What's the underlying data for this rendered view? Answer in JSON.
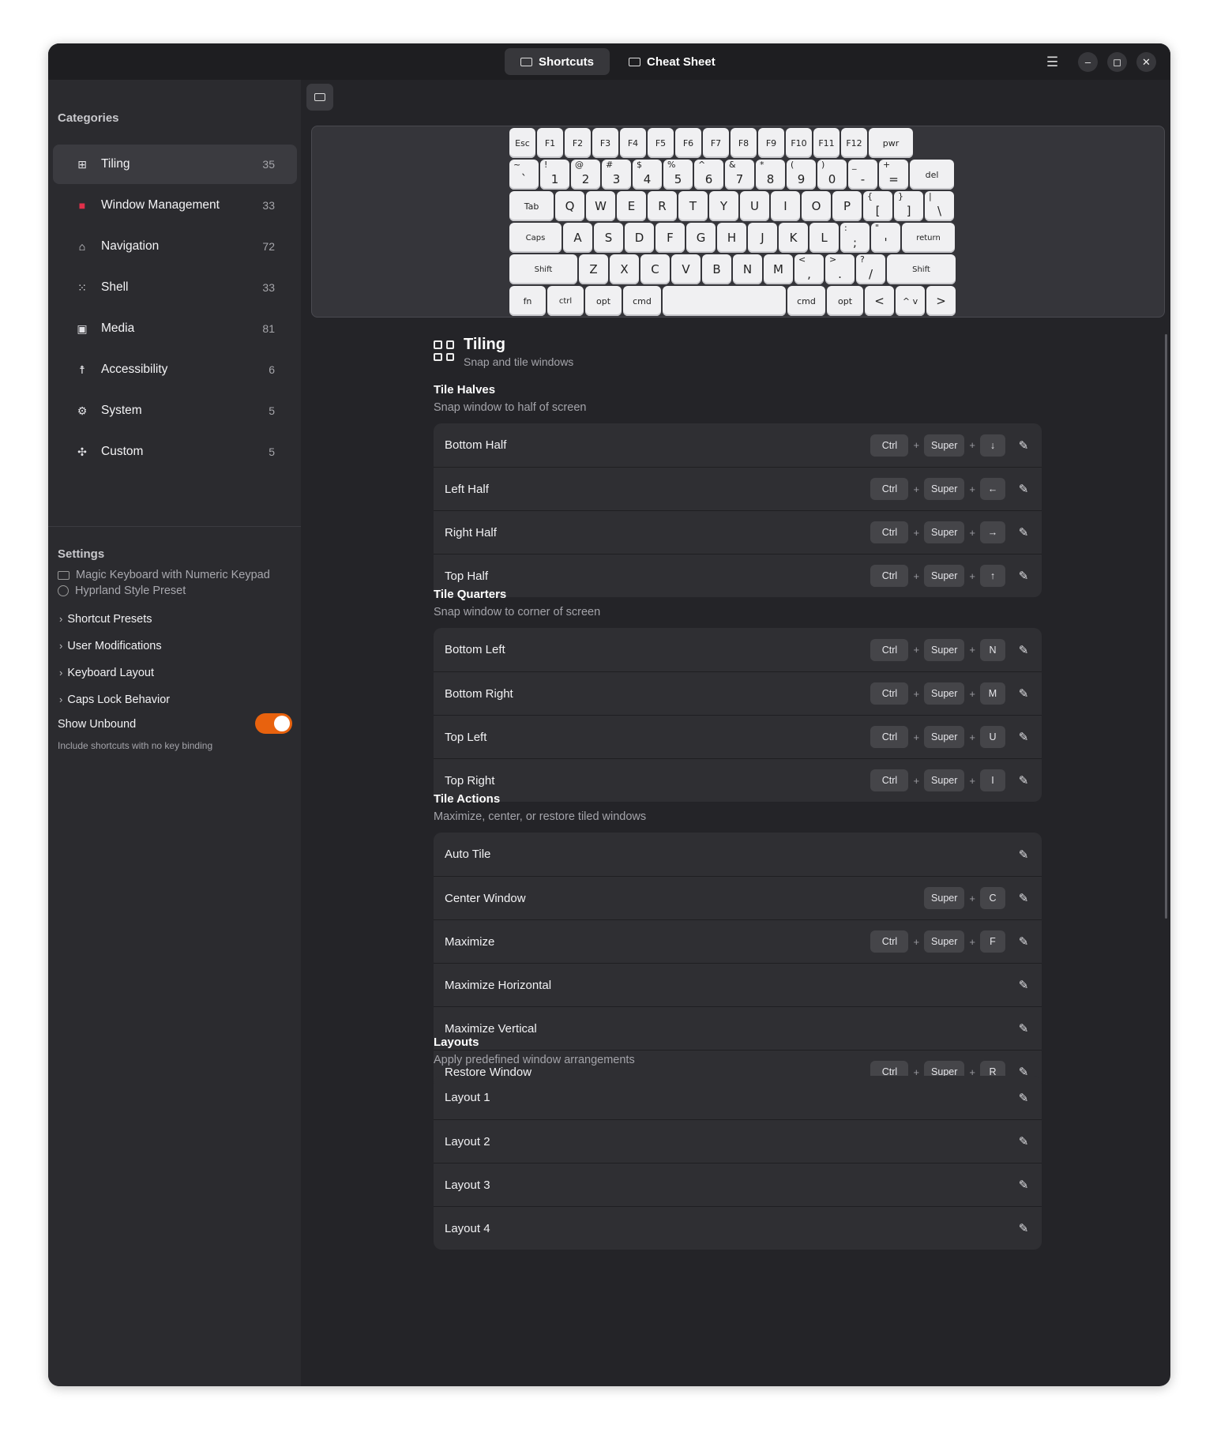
{
  "header": {
    "tabs": [
      {
        "label": "Shortcuts",
        "active": true
      },
      {
        "label": "Cheat Sheet",
        "active": false
      }
    ],
    "menu_glyph": "☰",
    "minimize_glyph": "–",
    "maximize_glyph": "◻",
    "close_glyph": "✕"
  },
  "sidebar": {
    "categories_heading": "Categories",
    "categories": [
      {
        "label": "Tiling",
        "count": "35",
        "icon": "grid-icon",
        "glyph": "⊞",
        "active": true
      },
      {
        "label": "Window Management",
        "count": "33",
        "icon": "window-icon",
        "glyph": "■",
        "color": "#e0304a"
      },
      {
        "label": "Navigation",
        "count": "72",
        "icon": "home-icon",
        "glyph": "⌂"
      },
      {
        "label": "Shell",
        "count": "33",
        "icon": "apps-grid-icon",
        "glyph": "⁙"
      },
      {
        "label": "Media",
        "count": "81",
        "icon": "speaker-icon",
        "glyph": "▣"
      },
      {
        "label": "Accessibility",
        "count": "6",
        "icon": "accessibility-icon",
        "glyph": "☨"
      },
      {
        "label": "System",
        "count": "5",
        "icon": "gear-icon",
        "glyph": "⚙"
      },
      {
        "label": "Custom",
        "count": "5",
        "icon": "puzzle-icon",
        "glyph": "✣"
      }
    ],
    "settings_heading": "Settings",
    "keyboard_model": "Magic Keyboard with Numeric Keypad",
    "preset": "Hyprland Style Preset",
    "expanders": [
      "Shortcut Presets",
      "User Modifications",
      "Keyboard Layout",
      "Caps Lock Behavior"
    ],
    "show_unbound": {
      "label": "Show Unbound",
      "sub": "Include shortcuts with no key binding",
      "on": true
    }
  },
  "keyboard": {
    "rows": [
      [
        {
          "m": "Esc",
          "w": 33,
          "c": "small"
        },
        {
          "m": "F1",
          "w": 33,
          "c": "small"
        },
        {
          "m": "F2",
          "w": 33,
          "c": "small"
        },
        {
          "m": "F3",
          "w": 33,
          "c": "small"
        },
        {
          "m": "F4",
          "w": 33,
          "c": "small"
        },
        {
          "m": "F5",
          "w": 33,
          "c": "small"
        },
        {
          "m": "F6",
          "w": 33,
          "c": "small"
        },
        {
          "m": "F7",
          "w": 33,
          "c": "small"
        },
        {
          "m": "F8",
          "w": 33,
          "c": "small"
        },
        {
          "m": "F9",
          "w": 33,
          "c": "small"
        },
        {
          "m": "F10",
          "w": 33,
          "c": "small"
        },
        {
          "m": "F11",
          "w": 33,
          "c": "small"
        },
        {
          "m": "F12",
          "w": 33,
          "c": "small"
        },
        {
          "m": "pwr",
          "w": 56,
          "c": "small"
        }
      ],
      [
        {
          "s": "~",
          "m": "`",
          "w": 37
        },
        {
          "s": "!",
          "m": "1",
          "w": 37
        },
        {
          "s": "@",
          "m": "2",
          "w": 37
        },
        {
          "s": "#",
          "m": "3",
          "w": 37
        },
        {
          "s": "$",
          "m": "4",
          "w": 37
        },
        {
          "s": "%",
          "m": "5",
          "w": 37
        },
        {
          "s": "^",
          "m": "6",
          "w": 37
        },
        {
          "s": "&",
          "m": "7",
          "w": 37
        },
        {
          "s": "*",
          "m": "8",
          "w": 37
        },
        {
          "s": "(",
          "m": "9",
          "w": 37
        },
        {
          "s": ")",
          "m": "0",
          "w": 37
        },
        {
          "s": "_",
          "m": "-",
          "w": 37
        },
        {
          "s": "+",
          "m": "=",
          "w": 37
        },
        {
          "m": "del",
          "w": 56,
          "c": "small"
        }
      ],
      [
        {
          "m": "Tab",
          "w": 56,
          "c": "small"
        },
        {
          "m": "Q",
          "w": 37
        },
        {
          "m": "W",
          "w": 37
        },
        {
          "m": "E",
          "w": 37
        },
        {
          "m": "R",
          "w": 37
        },
        {
          "m": "T",
          "w": 37
        },
        {
          "m": "Y",
          "w": 37
        },
        {
          "m": "U",
          "w": 37
        },
        {
          "m": "I",
          "w": 37
        },
        {
          "m": "O",
          "w": 37
        },
        {
          "m": "P",
          "w": 37
        },
        {
          "s": "{",
          "m": "[",
          "w": 37
        },
        {
          "s": "}",
          "m": "]",
          "w": 37
        },
        {
          "s": "|",
          "m": "\\",
          "w": 37
        }
      ],
      [
        {
          "m": "Caps",
          "w": 66,
          "c": "tiny"
        },
        {
          "m": "A",
          "w": 37
        },
        {
          "m": "S",
          "w": 37
        },
        {
          "m": "D",
          "w": 37
        },
        {
          "m": "F",
          "w": 37
        },
        {
          "m": "G",
          "w": 37
        },
        {
          "m": "H",
          "w": 37
        },
        {
          "m": "J",
          "w": 37
        },
        {
          "m": "K",
          "w": 37
        },
        {
          "m": "L",
          "w": 37
        },
        {
          "s": ":",
          "m": ";",
          "w": 37
        },
        {
          "s": "\"",
          "m": "'",
          "w": 37
        },
        {
          "m": "return",
          "w": 67,
          "c": "tiny"
        }
      ],
      [
        {
          "m": "Shift",
          "w": 86,
          "c": "tiny"
        },
        {
          "m": "Z",
          "w": 37
        },
        {
          "m": "X",
          "w": 37
        },
        {
          "m": "C",
          "w": 37
        },
        {
          "m": "V",
          "w": 37
        },
        {
          "m": "B",
          "w": 37
        },
        {
          "m": "N",
          "w": 37
        },
        {
          "m": "M",
          "w": 37
        },
        {
          "s": "<",
          "m": ",",
          "w": 37
        },
        {
          "s": ">",
          "m": ".",
          "w": 37
        },
        {
          "s": "?",
          "m": "/",
          "w": 37
        },
        {
          "m": "Shift",
          "w": 87,
          "c": "tiny"
        }
      ],
      [
        {
          "m": "fn",
          "w": 46,
          "c": "small"
        },
        {
          "m": "ctrl",
          "w": 46,
          "c": "tiny"
        },
        {
          "m": "opt",
          "w": 46,
          "c": "small"
        },
        {
          "m": "cmd",
          "w": 48,
          "c": "small"
        },
        {
          "m": "",
          "w": 156
        },
        {
          "m": "cmd",
          "w": 48,
          "c": "small"
        },
        {
          "m": "opt",
          "w": 46,
          "c": "small"
        },
        {
          "m": "<",
          "w": 37
        },
        {
          "m": "^ v",
          "w": 37,
          "c": "small"
        },
        {
          "m": ">",
          "w": 37
        }
      ]
    ]
  },
  "main": {
    "category_title": "Tiling",
    "category_sub": "Snap and tile windows",
    "sections": [
      {
        "title": "Tile Halves",
        "sub": "Snap window to half of screen",
        "rows": [
          {
            "label": "Bottom Half",
            "keys": [
              "Ctrl",
              "Super",
              "↓"
            ]
          },
          {
            "label": "Left Half",
            "keys": [
              "Ctrl",
              "Super",
              "←"
            ]
          },
          {
            "label": "Right Half",
            "keys": [
              "Ctrl",
              "Super",
              "→"
            ]
          },
          {
            "label": "Top Half",
            "keys": [
              "Ctrl",
              "Super",
              "↑"
            ]
          }
        ]
      },
      {
        "title": "Tile Quarters",
        "sub": "Snap window to corner of screen",
        "rows": [
          {
            "label": "Bottom Left",
            "keys": [
              "Ctrl",
              "Super",
              "N"
            ]
          },
          {
            "label": "Bottom Right",
            "keys": [
              "Ctrl",
              "Super",
              "M"
            ]
          },
          {
            "label": "Top Left",
            "keys": [
              "Ctrl",
              "Super",
              "U"
            ]
          },
          {
            "label": "Top Right",
            "keys": [
              "Ctrl",
              "Super",
              "I"
            ]
          }
        ]
      },
      {
        "title": "Tile Actions",
        "sub": "Maximize, center, or restore tiled windows",
        "rows": [
          {
            "label": "Auto Tile",
            "keys": []
          },
          {
            "label": "Center Window",
            "keys": [
              "Super",
              "C"
            ]
          },
          {
            "label": "Maximize",
            "keys": [
              "Ctrl",
              "Super",
              "F"
            ]
          },
          {
            "label": "Maximize Horizontal",
            "keys": []
          },
          {
            "label": "Maximize Vertical",
            "keys": []
          },
          {
            "label": "Restore Window",
            "keys": [
              "Ctrl",
              "Super",
              "R"
            ]
          }
        ]
      },
      {
        "title": "Layouts",
        "sub": "Apply predefined window arrangements",
        "rows": [
          {
            "label": "Layout 1",
            "keys": []
          },
          {
            "label": "Layout 2",
            "keys": []
          },
          {
            "label": "Layout 3",
            "keys": []
          },
          {
            "label": "Layout 4",
            "keys": []
          }
        ]
      }
    ],
    "plus_glyph": "+",
    "edit_glyph": "✎"
  }
}
